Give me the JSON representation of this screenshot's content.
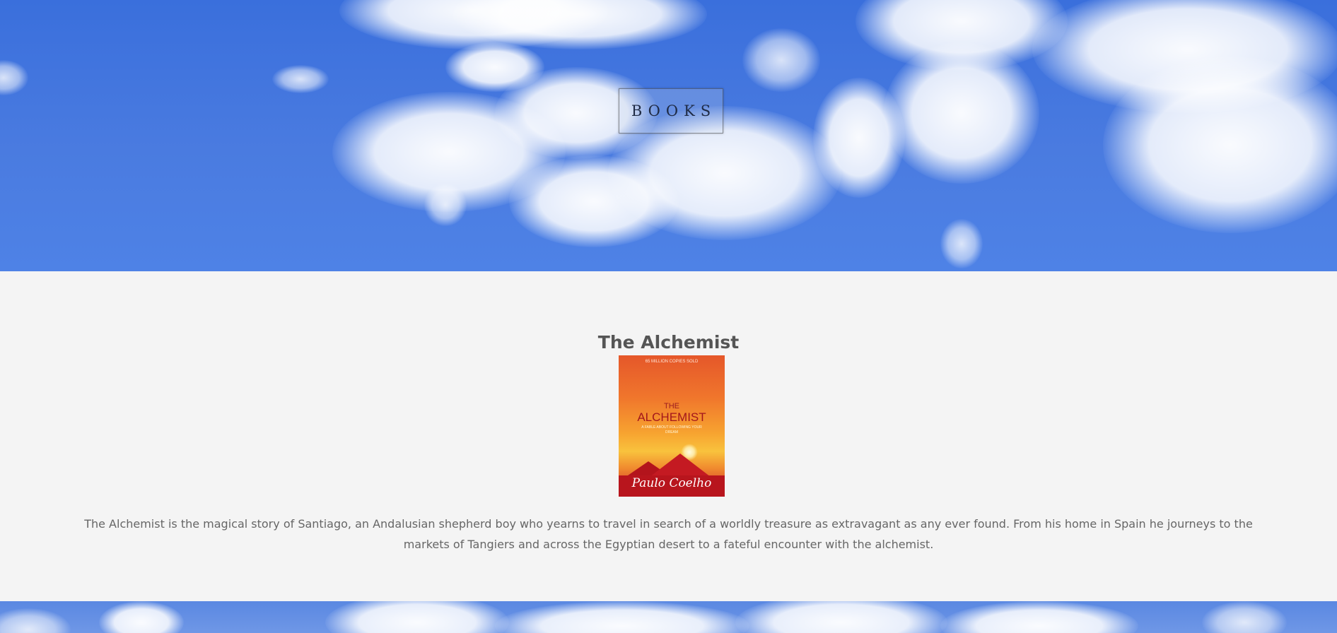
{
  "header": {
    "button_label": "BOOKS"
  },
  "book": {
    "title": "The Alchemist",
    "cover": {
      "top_line": "65 MILLION COPIES SOLD",
      "the": "THE",
      "name": "ALCHEMIST",
      "tagline": "A FABLE ABOUT FOLLOWING YOUR DREAM",
      "author": "Paulo Coelho"
    },
    "description": "The Alchemist is the magical story of Santiago, an Andalusian shepherd boy who yearns to travel in search of a worldly treasure as extravagant as any ever found. From his home in Spain he journeys to the markets of Tangiers and across the Egyptian desert to a fateful encounter with the alchemist."
  },
  "colors": {
    "sky": "#3a6fdc",
    "content_background": "#f4f4f4",
    "title_text": "#555555",
    "body_text": "#666666"
  }
}
